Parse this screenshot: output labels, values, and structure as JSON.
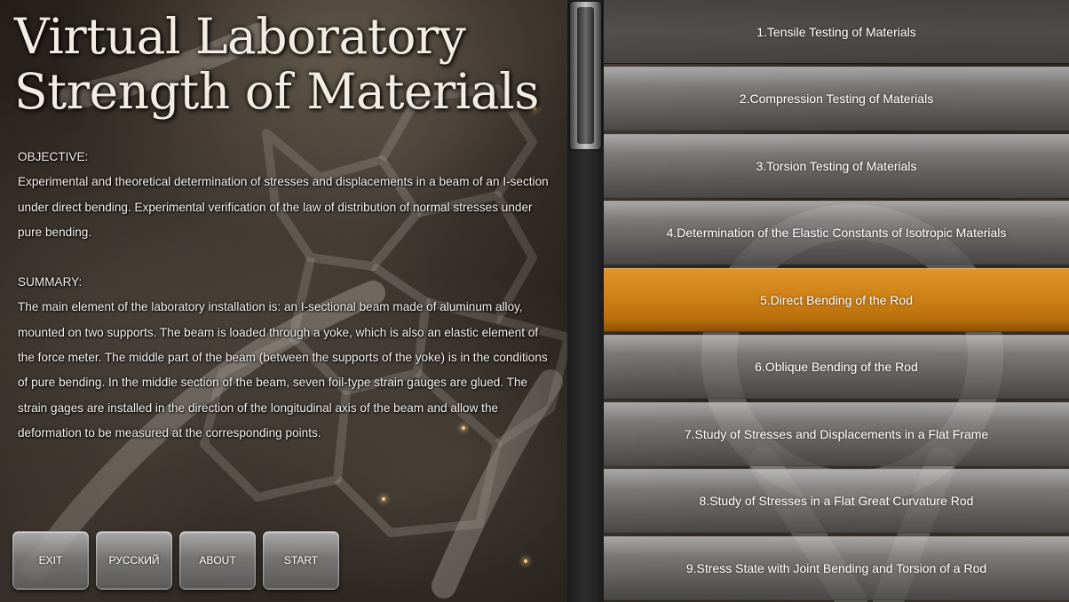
{
  "app": {
    "title_line1": "Virtual Laboratory",
    "title_line2": "Strength of Materials"
  },
  "description": {
    "objective_heading": "OBJECTIVE:",
    "objective_text": "Experimental and theoretical determination of stresses and displacements in a beam of an I-section under direct bending. Experimental verification of the law of distribution of normal stresses under pure bending.",
    "summary_heading": "SUMMARY:",
    "summary_text": "The main element of the laboratory installation is: an I-sectional beam made of aluminum alloy, mounted on two supports. The beam is loaded through a yoke, which is also an elastic element of the force meter. The middle part of the beam (between the supports of the yoke) is in the conditions of pure bending. In the middle section of the beam, seven foil-type strain gauges are glued. The strain gages are installed in the direction of the longitudinal axis of the beam and allow the deformation to be measured at the corresponding points."
  },
  "buttons": {
    "exit": "EXIT",
    "language": "РУССКИЙ",
    "about": "ABOUT",
    "start": "START"
  },
  "labs": [
    {
      "label": "1.Tensile Testing of Materials"
    },
    {
      "label": "2.Compression Testing of Materials"
    },
    {
      "label": "3.Torsion Testing of Materials"
    },
    {
      "label": "4.Determination of the Elastic Constants of Isotropic Materials"
    },
    {
      "label": "5.Direct Bending of the Rod"
    },
    {
      "label": "6.Oblique Bending of the Rod"
    },
    {
      "label": "7.Study of Stresses and Displacements in a Flat Frame"
    },
    {
      "label": "8.Study of Stresses in a Flat Great Curvature Rod"
    },
    {
      "label": "9.Stress State with Joint Bending and Torsion of a Rod"
    }
  ],
  "selected_lab_index": 4,
  "colors": {
    "accent": "#d08418",
    "text": "#ffffff"
  }
}
